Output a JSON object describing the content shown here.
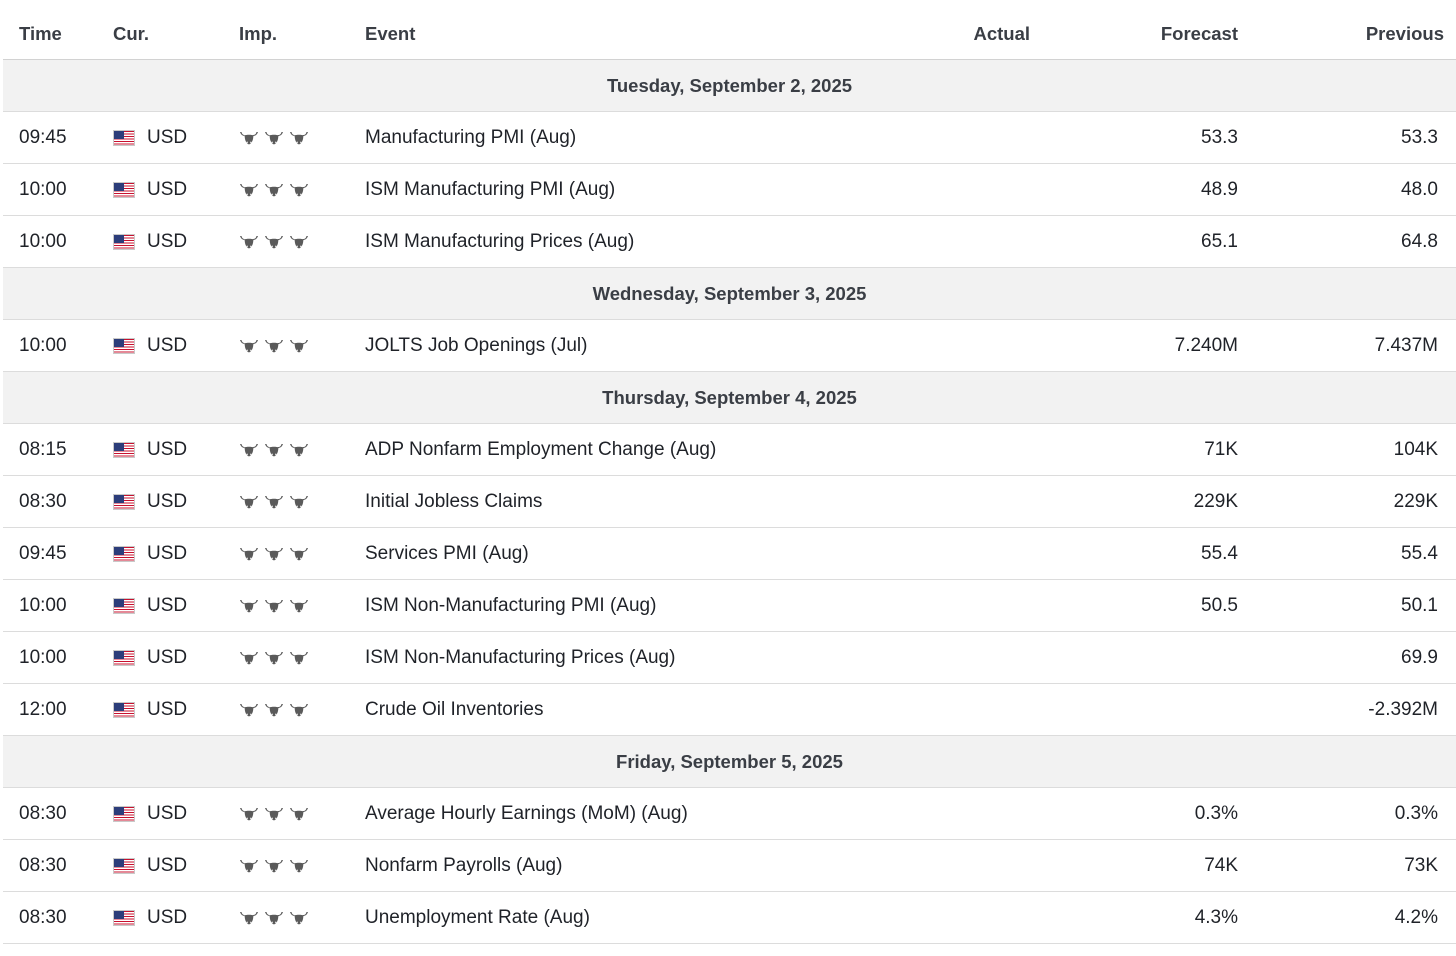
{
  "columns": {
    "time": "Time",
    "currency": "Cur.",
    "importance": "Imp.",
    "event": "Event",
    "actual": "Actual",
    "forecast": "Forecast",
    "previous": "Previous"
  },
  "icons": {
    "flag": "us-flag-icon",
    "importance": "bull-icon"
  },
  "colors": {
    "date_row_bg": "#f2f2f2",
    "bull": "#5a5a5a"
  },
  "importance_level": 3,
  "rows": [
    {
      "type": "date",
      "label": "Tuesday, September 2, 2025"
    },
    {
      "type": "event",
      "time": "09:45",
      "currency": "USD",
      "event": "Manufacturing PMI (Aug)",
      "actual": "",
      "forecast": "53.3",
      "previous": "53.3"
    },
    {
      "type": "event",
      "time": "10:00",
      "currency": "USD",
      "event": "ISM Manufacturing PMI (Aug)",
      "actual": "",
      "forecast": "48.9",
      "previous": "48.0"
    },
    {
      "type": "event",
      "time": "10:00",
      "currency": "USD",
      "event": "ISM Manufacturing Prices (Aug)",
      "actual": "",
      "forecast": "65.1",
      "previous": "64.8"
    },
    {
      "type": "date",
      "label": "Wednesday, September 3, 2025"
    },
    {
      "type": "event",
      "time": "10:00",
      "currency": "USD",
      "event": "JOLTS Job Openings (Jul)",
      "actual": "",
      "forecast": "7.240M",
      "previous": "7.437M"
    },
    {
      "type": "date",
      "label": "Thursday, September 4, 2025"
    },
    {
      "type": "event",
      "time": "08:15",
      "currency": "USD",
      "event": "ADP Nonfarm Employment Change (Aug)",
      "actual": "",
      "forecast": "71K",
      "previous": "104K"
    },
    {
      "type": "event",
      "time": "08:30",
      "currency": "USD",
      "event": "Initial Jobless Claims",
      "actual": "",
      "forecast": "229K",
      "previous": "229K"
    },
    {
      "type": "event",
      "time": "09:45",
      "currency": "USD",
      "event": "Services PMI (Aug)",
      "actual": "",
      "forecast": "55.4",
      "previous": "55.4"
    },
    {
      "type": "event",
      "time": "10:00",
      "currency": "USD",
      "event": "ISM Non-Manufacturing PMI (Aug)",
      "actual": "",
      "forecast": "50.5",
      "previous": "50.1"
    },
    {
      "type": "event",
      "time": "10:00",
      "currency": "USD",
      "event": "ISM Non-Manufacturing Prices (Aug)",
      "actual": "",
      "forecast": "",
      "previous": "69.9"
    },
    {
      "type": "event",
      "time": "12:00",
      "currency": "USD",
      "event": "Crude Oil Inventories",
      "actual": "",
      "forecast": "",
      "previous": "-2.392M"
    },
    {
      "type": "date",
      "label": "Friday, September 5, 2025"
    },
    {
      "type": "event",
      "time": "08:30",
      "currency": "USD",
      "event": "Average Hourly Earnings (MoM) (Aug)",
      "actual": "",
      "forecast": "0.3%",
      "previous": "0.3%"
    },
    {
      "type": "event",
      "time": "08:30",
      "currency": "USD",
      "event": "Nonfarm Payrolls (Aug)",
      "actual": "",
      "forecast": "74K",
      "previous": "73K"
    },
    {
      "type": "event",
      "time": "08:30",
      "currency": "USD",
      "event": "Unemployment Rate (Aug)",
      "actual": "",
      "forecast": "4.3%",
      "previous": "4.2%"
    }
  ]
}
